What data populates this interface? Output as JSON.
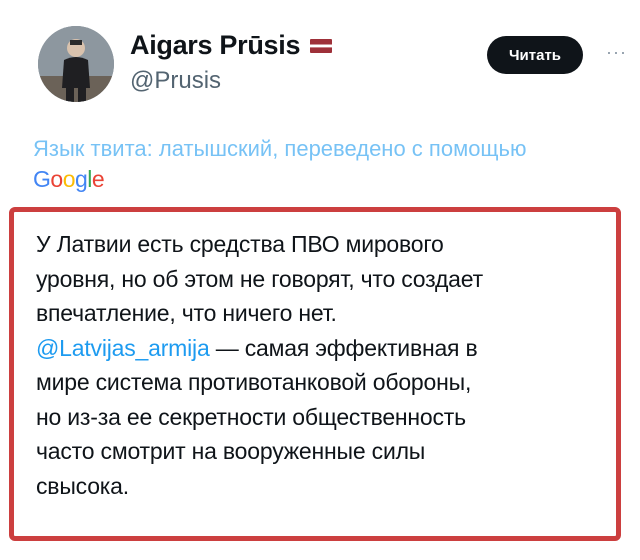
{
  "user": {
    "display_name": "Aigars Prūsis",
    "handle": "@Prusis",
    "flag_colors": [
      "#9E3039",
      "#ffffff",
      "#9E3039"
    ],
    "avatar_alt": "avatar"
  },
  "actions": {
    "follow_label": "Читать",
    "more_icon": "more-icon"
  },
  "translation": {
    "notice": "Язык твита: латышский, переведено с помощью",
    "provider_letters": [
      {
        "char": "G",
        "color": "#4285F4"
      },
      {
        "char": "o",
        "color": "#EA4335"
      },
      {
        "char": "o",
        "color": "#FBBC05"
      },
      {
        "char": "g",
        "color": "#4285F4"
      },
      {
        "char": "l",
        "color": "#34A853"
      },
      {
        "char": "e",
        "color": "#EA4335"
      }
    ]
  },
  "tweet": {
    "line1": "У Латвии есть средства ПВО мирового",
    "line2": "уровня, но об этом не говорят, что создает",
    "line3": "впечатление, что ничего нет.",
    "mention": "@Latvijas_armija",
    "line4_rest": " — самая эффективная в",
    "line5": "мире система противотанковой обороны,",
    "line6": "но из-за ее секретности общественность",
    "line7": "часто смотрит на вооруженные силы",
    "line8": "свысока."
  },
  "colors": {
    "highlight_border": "#cc3f3f",
    "link": "#1d9bf0"
  }
}
